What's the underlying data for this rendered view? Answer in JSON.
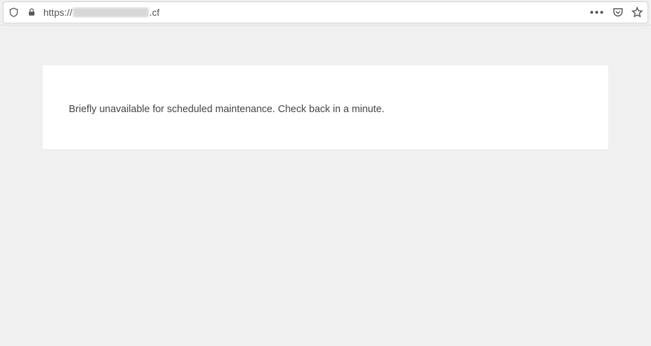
{
  "address_bar": {
    "url_prefix": "https://",
    "url_suffix": ".cf"
  },
  "page": {
    "message": "Briefly unavailable for scheduled maintenance. Check back in a minute."
  }
}
